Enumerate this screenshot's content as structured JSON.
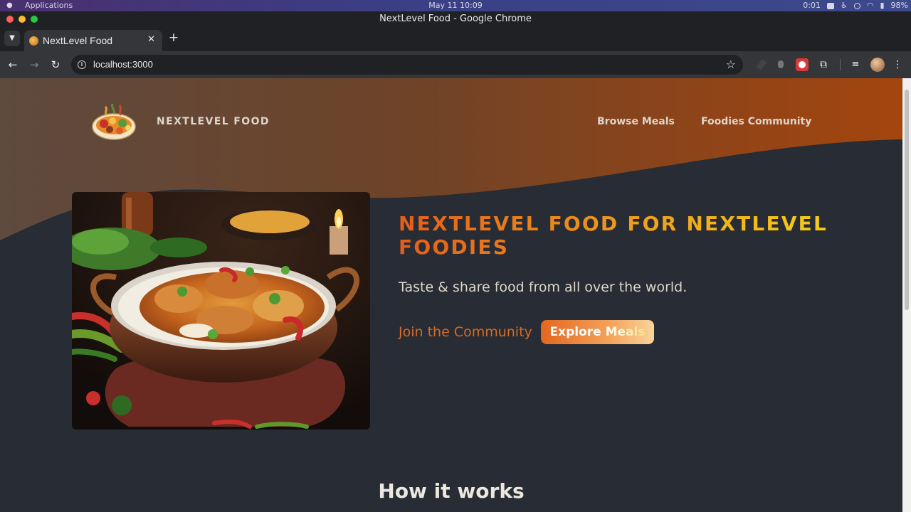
{
  "os": {
    "apps_label": "Applications",
    "clock": "May 11  10:09",
    "tray_time": "0:01",
    "battery": "98%"
  },
  "window": {
    "title": "NextLevel Food - Google Chrome"
  },
  "tabs": [
    {
      "label": "NextLevel Food",
      "active": true
    }
  ],
  "toolbar": {
    "url": "localhost:3000"
  },
  "icons": {
    "apple": "apple-icon",
    "back": "arrow-left-icon",
    "forward": "arrow-right-icon",
    "reload": "reload-icon",
    "info": "info-icon",
    "bookmark": "star-icon",
    "extensions": "puzzle-icon",
    "media": "media-queue-icon",
    "menu": "kebab-menu-icon"
  },
  "page": {
    "brand": "NEXTLEVEL FOOD",
    "nav": {
      "browse": "Browse Meals",
      "community": "Foodies Community"
    },
    "hero": {
      "title": "NextLevel Food for NextLevel Foodies",
      "subtitle": "Taste & share food from all over the world.",
      "join_link": "Join the Community",
      "cta": "Explore Meals"
    },
    "how_title": "How it works"
  },
  "colors": {
    "page_bg": "#282c34",
    "hero_gradient_start": "#5e4a3e",
    "hero_gradient_end": "#a4450e",
    "accent_orange": "#e45d1b",
    "accent_yellow": "#f6d31a"
  }
}
